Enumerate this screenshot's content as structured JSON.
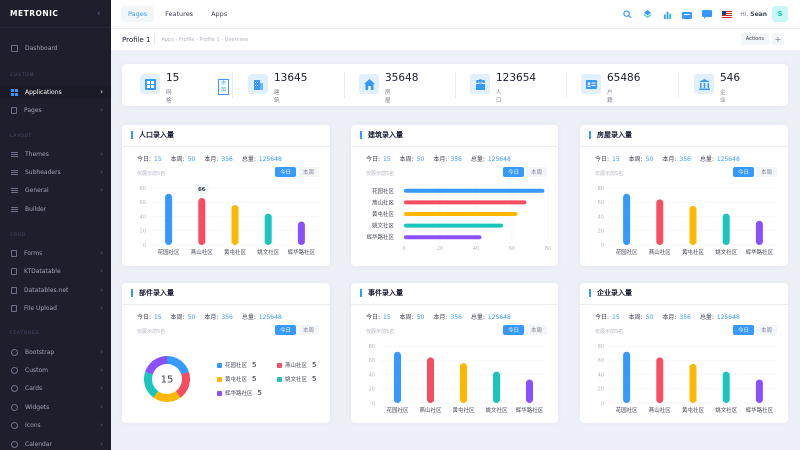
{
  "brand": {
    "name": "METRONIC",
    "toggle": "‹"
  },
  "sidebar": {
    "sections": [
      "CUSTOM",
      "LAYOUT",
      "CRUD",
      "FEATURES"
    ],
    "items": [
      {
        "label": "Dashboard",
        "icon": "home-icon"
      },
      {
        "label": "Applications",
        "icon": "grid-icon",
        "active": true
      },
      {
        "label": "Pages",
        "icon": "page-icon"
      },
      {
        "label": "Themes",
        "icon": "layers-icon"
      },
      {
        "label": "Subheaders",
        "icon": "layers-icon"
      },
      {
        "label": "General",
        "icon": "layers-icon"
      },
      {
        "label": "Builder",
        "icon": "layers-icon"
      },
      {
        "label": "Forms",
        "icon": "page-icon"
      },
      {
        "label": "KTDatatable",
        "icon": "page-icon"
      },
      {
        "label": "Datatables.net",
        "icon": "page-icon"
      },
      {
        "label": "File Upload",
        "icon": "page-icon"
      },
      {
        "label": "Bootstrap",
        "icon": "circle-icon"
      },
      {
        "label": "Custom",
        "icon": "circle-icon"
      },
      {
        "label": "Cards",
        "icon": "circle-icon"
      },
      {
        "label": "Widgets",
        "icon": "circle-icon"
      },
      {
        "label": "Icons",
        "icon": "circle-icon"
      },
      {
        "label": "Calendar",
        "icon": "circle-icon"
      }
    ]
  },
  "topnav": {
    "tabs": [
      "Pages",
      "Features",
      "Apps"
    ],
    "greeting": "Hi,",
    "user": "Sean",
    "avatar": "S"
  },
  "subheader": {
    "title": "Profile 1",
    "breadcrumb": "Apps  -  Profile  -  Profile 1  -  Overview",
    "actions": "Actions",
    "plus": "+"
  },
  "stats": [
    {
      "value": "15",
      "label": "网格",
      "icon": "grid-icon",
      "button": "添加"
    },
    {
      "value": "13645",
      "label": "建筑",
      "icon": "building-icon"
    },
    {
      "value": "35648",
      "label": "房屋",
      "icon": "house-icon"
    },
    {
      "value": "123654",
      "label": "人口",
      "icon": "people-icon"
    },
    {
      "value": "65486",
      "label": "户籍",
      "icon": "id-card-icon"
    },
    {
      "value": "546",
      "label": "企业",
      "icon": "enterprise-icon"
    }
  ],
  "card_common": {
    "today_label": "今日:",
    "week_label": "本周:",
    "month_label": "本月:",
    "total_label": "总量:",
    "btn_today": "今日",
    "btn_week": "本周",
    "note": "仅展示前5名"
  },
  "cards": [
    {
      "title": "人口录入量",
      "today": "15",
      "week": "50",
      "month": "356",
      "total": "125648"
    },
    {
      "title": "建筑录入量",
      "today": "15",
      "week": "50",
      "month": "356",
      "total": "125648"
    },
    {
      "title": "房屋录入量",
      "today": "15",
      "week": "50",
      "month": "356",
      "total": "125648"
    },
    {
      "title": "部件录入量",
      "today": "15",
      "week": "50",
      "month": "356",
      "total": "125648"
    },
    {
      "title": "事件录入量",
      "today": "15",
      "week": "50",
      "month": "356",
      "total": "125648"
    },
    {
      "title": "企业录入量",
      "today": "15",
      "week": "50",
      "month": "356",
      "total": "125648"
    }
  ],
  "chart_data": [
    {
      "type": "bar",
      "categories": [
        "花园社区",
        "燕山社区",
        "黄屯社区",
        "姚文社区",
        "辉华路社区"
      ],
      "values": [
        72,
        66,
        56,
        44,
        33
      ],
      "ylim": [
        0,
        80
      ],
      "yticks": [
        0,
        20,
        40,
        60,
        80
      ],
      "tooltip": "66",
      "colors": [
        "#3699ff",
        "#f64e60",
        "#ffb800",
        "#1bc5bd",
        "#8950fc"
      ]
    },
    {
      "type": "bar",
      "orientation": "horizontal",
      "categories": [
        "花园社区",
        "燕山社区",
        "黄屯社区",
        "姚文社区",
        "辉华路社区"
      ],
      "values": [
        78,
        68,
        63,
        55,
        43
      ],
      "xlim": [
        0,
        80
      ],
      "xticks": [
        0,
        20,
        40,
        60,
        80
      ],
      "colors": [
        "#3699ff",
        "#f64e60",
        "#ffb800",
        "#1bc5bd",
        "#8950fc"
      ]
    },
    {
      "type": "bar",
      "categories": [
        "花园社区",
        "燕山社区",
        "黄屯社区",
        "姚文社区",
        "辉华路社区"
      ],
      "values": [
        72,
        64,
        55,
        44,
        34
      ],
      "ylim": [
        0,
        80
      ],
      "yticks": [
        0,
        20,
        40,
        60,
        80
      ],
      "colors": [
        "#3699ff",
        "#f64e60",
        "#ffb800",
        "#1bc5bd",
        "#8950fc"
      ]
    },
    {
      "type": "pie",
      "center_label": "15",
      "categories": [
        "花园社区",
        "燕山社区",
        "黄屯社区",
        "姚文社区",
        "辉华路社区"
      ],
      "values": [
        5,
        5,
        5,
        5,
        5
      ],
      "colors": [
        "#3699ff",
        "#f64e60",
        "#ffb800",
        "#1bc5bd",
        "#8950fc"
      ]
    },
    {
      "type": "bar",
      "categories": [
        "花园社区",
        "燕山社区",
        "黄屯社区",
        "姚文社区",
        "辉华路社区"
      ],
      "values": [
        72,
        64,
        56,
        44,
        33
      ],
      "ylim": [
        0,
        80
      ],
      "yticks": [
        0,
        20,
        40,
        60,
        80
      ],
      "colors": [
        "#3699ff",
        "#f64e60",
        "#ffb800",
        "#1bc5bd",
        "#8950fc"
      ]
    },
    {
      "type": "bar",
      "categories": [
        "花园社区",
        "燕山社区",
        "黄屯社区",
        "姚文社区",
        "辉华路社区"
      ],
      "values": [
        72,
        64,
        55,
        44,
        33
      ],
      "ylim": [
        0,
        80
      ],
      "yticks": [
        0,
        20,
        40,
        60,
        80
      ],
      "colors": [
        "#3699ff",
        "#f64e60",
        "#ffb800",
        "#1bc5bd",
        "#8950fc"
      ]
    }
  ]
}
